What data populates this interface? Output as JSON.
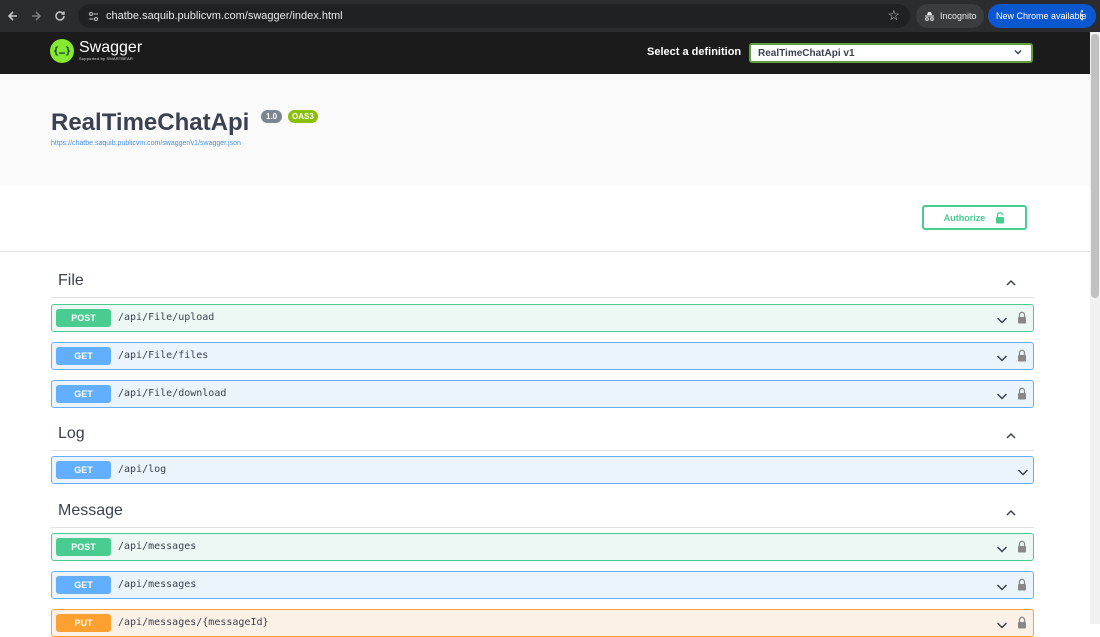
{
  "browser": {
    "url": "chatbe.saquib.publicvm.com/swagger/index.html",
    "incognito_label": "Incognito",
    "update_label": "New Chrome available"
  },
  "topbar": {
    "logo_name": "Swagger",
    "logo_sub": "Supported by SMARTBEAR",
    "select_label": "Select a definition",
    "select_value": "RealTimeChatApi v1"
  },
  "info": {
    "title": "RealTimeChatApi",
    "version": "1.0",
    "oas": "OAS3",
    "spec_url": "https://chatbe.saquib.publicvm.com/swagger/v1/swagger.json"
  },
  "authorize_label": "Authorize",
  "sections": [
    {
      "name": "File"
    },
    {
      "name": "Log"
    },
    {
      "name": "Message"
    }
  ],
  "operations": [
    {
      "method": "POST",
      "path": "/api/File/upload"
    },
    {
      "method": "GET",
      "path": "/api/File/files"
    },
    {
      "method": "GET",
      "path": "/api/File/download"
    },
    {
      "method": "GET",
      "path": "/api/log"
    },
    {
      "method": "POST",
      "path": "/api/messages"
    },
    {
      "method": "GET",
      "path": "/api/messages"
    },
    {
      "method": "PUT",
      "path": "/api/messages/{messageId}"
    }
  ],
  "colors": {
    "post": "#49cc90",
    "get": "#61affe",
    "put": "#fca130",
    "swagger_green": "#85ea2d"
  }
}
